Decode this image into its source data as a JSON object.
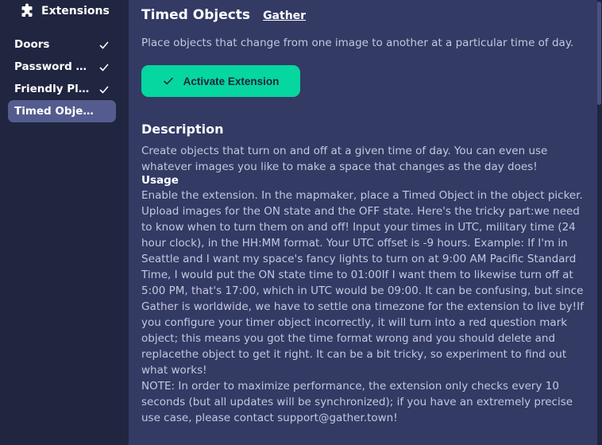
{
  "sidebar": {
    "title": "Extensions",
    "items": [
      {
        "label": "Doors",
        "enabled": true
      },
      {
        "label": "Password Do...",
        "enabled": true
      },
      {
        "label": "Friendly Plant",
        "enabled": true
      },
      {
        "label": "Timed Obje...",
        "enabled": false,
        "active": true
      }
    ]
  },
  "main": {
    "title": "Timed Objects",
    "author": "Gather",
    "subtitle": "Place objects that change from one image to another at a particular time of day.",
    "activate_label": "Activate Extension",
    "description_heading": "Description",
    "description": "Create objects that turn on and off at a given time of day. You can even use whatever images you like to make a space that changes as the day does!",
    "usage_heading": "Usage",
    "usage": "Enable the extension. In the mapmaker, place a Timed Object in the object picker. Upload images for the ON state and the OFF state. Here's the tricky part:we need to know when to turn them on and off! Input your times in UTC, military time (24 hour clock), in the HH:MM format. Your UTC offset is -9 hours. Example: If I'm in Seattle and I want my space's fancy lights to turn on at 9:00 AM Pacific Standard Time, I would put the ON state time to 01:00If I want them to likewise turn off at 5:00 PM, that's 17:00, which in UTC would be 09:00. It can be confusing, but since Gather is worldwide, we have to settle ona timezone for the extension to live by!If you configure your timer object incorrectly, it will turn into a red question mark object; this means you got the time format wrong and you should delete and replacethe object to get it right. It can be a bit tricky, so experiment to find out what works!",
    "note": "NOTE: In order to maximize performance, the extension only checks every 10 seconds (but all updates will be synchronized); if you have an extremely precise use case, please contact support@gather.town!"
  },
  "colors": {
    "sidebar_bg": "#202540",
    "main_bg": "#333a64",
    "active_item_bg": "#545c8f",
    "accent_button": "#06d6a0",
    "body_text": "#c4c8de"
  },
  "icons": {
    "header": "puzzle-icon",
    "enabled_item": "check-icon",
    "button": "check-icon"
  }
}
